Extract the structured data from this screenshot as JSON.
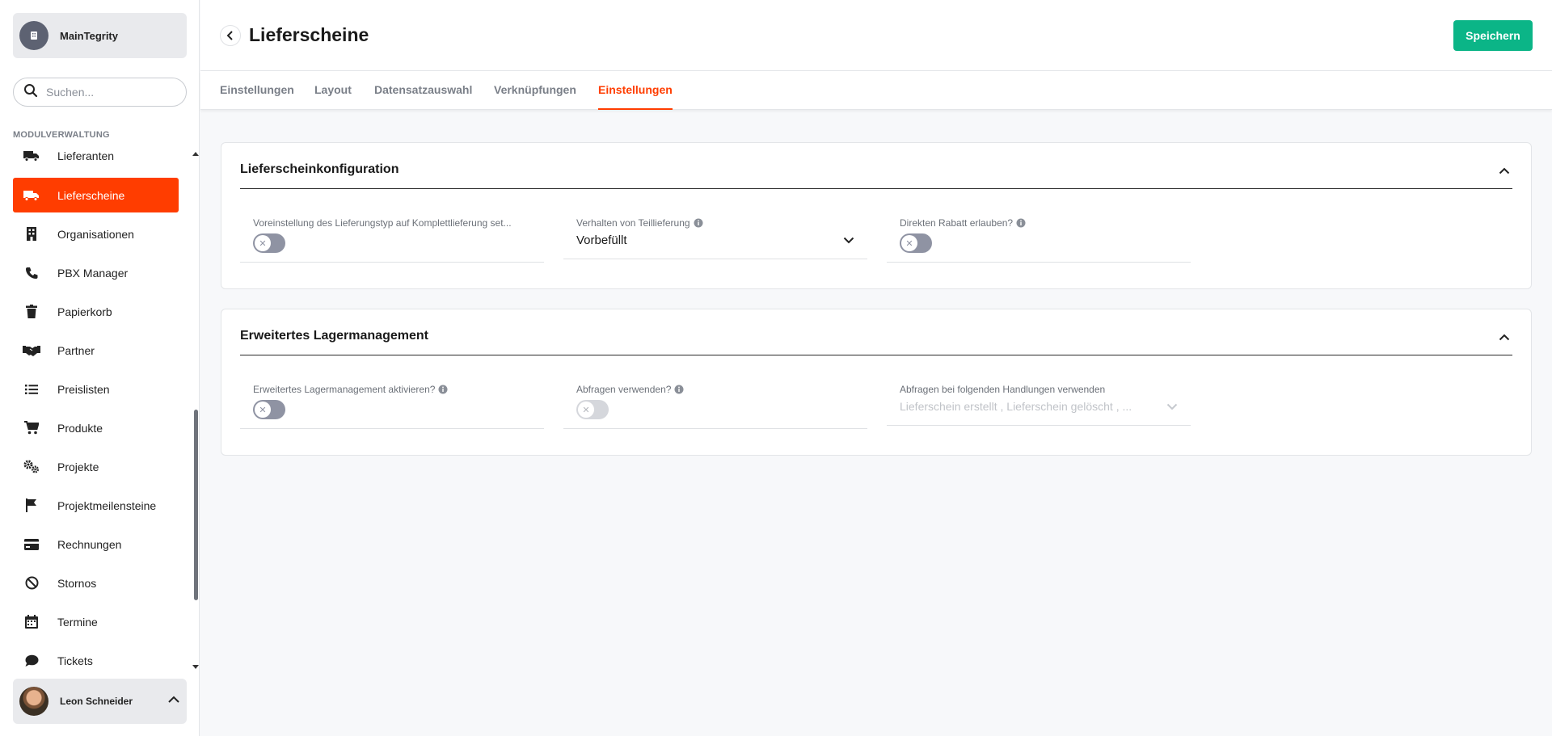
{
  "sidebar": {
    "org_name": "MainTegrity",
    "search_placeholder": "Suchen...",
    "section_label": "MODULVERWALTUNG",
    "items": [
      {
        "label": "Lieferanten",
        "icon": "truck-icon",
        "active": false
      },
      {
        "label": "Lieferscheine",
        "icon": "truck-icon",
        "active": true
      },
      {
        "label": "Organisationen",
        "icon": "building-icon",
        "active": false
      },
      {
        "label": "PBX Manager",
        "icon": "phone-icon",
        "active": false
      },
      {
        "label": "Papierkorb",
        "icon": "trash-icon",
        "active": false
      },
      {
        "label": "Partner",
        "icon": "handshake-icon",
        "active": false
      },
      {
        "label": "Preislisten",
        "icon": "list-icon",
        "active": false
      },
      {
        "label": "Produkte",
        "icon": "cart-icon",
        "active": false
      },
      {
        "label": "Projekte",
        "icon": "gears-icon",
        "active": false
      },
      {
        "label": "Projektmeilensteine",
        "icon": "flag-icon",
        "active": false
      },
      {
        "label": "Rechnungen",
        "icon": "credit-card-icon",
        "active": false
      },
      {
        "label": "Stornos",
        "icon": "ban-icon",
        "active": false
      },
      {
        "label": "Termine",
        "icon": "calendar-icon",
        "active": false
      },
      {
        "label": "Tickets",
        "icon": "chat-bubble-icon",
        "active": false
      }
    ],
    "user_name": "Leon Schneider"
  },
  "header": {
    "title": "Lieferscheine",
    "save_label": "Speichern"
  },
  "tabs": [
    {
      "label": "Einstellungen",
      "active": false
    },
    {
      "label": "Layout",
      "active": false
    },
    {
      "label": "Datensatzauswahl",
      "active": false
    },
    {
      "label": "Verknüpfungen",
      "active": false
    },
    {
      "label": "Einstellungen",
      "active": true
    }
  ],
  "sections": [
    {
      "title": "Lieferscheinkonfiguration",
      "fields": [
        {
          "label": "Voreinstellung des Lieferungstyp auf Komplettlieferung set...",
          "type": "switch",
          "on": false,
          "info": false
        },
        {
          "label": "Verhalten von Teillieferung",
          "type": "select",
          "value": "Vorbefüllt",
          "info": true
        },
        {
          "label": "Direkten Rabatt erlauben?",
          "type": "switch",
          "on": false,
          "info": true
        }
      ]
    },
    {
      "title": "Erweitertes Lagermanagement",
      "fields": [
        {
          "label": "Erweitertes Lagermanagement aktivieren?",
          "type": "switch",
          "on": false,
          "info": true
        },
        {
          "label": "Abfragen verwenden?",
          "type": "switch",
          "on": false,
          "disabled": true,
          "info": true
        },
        {
          "label": "Abfragen bei folgenden Handlungen verwenden",
          "type": "select",
          "value": "Lieferschein erstellt , Lieferschein gelöscht , ...",
          "disabled": true,
          "info": false
        }
      ]
    }
  ],
  "colors": {
    "accent": "#ff3d00",
    "save": "#0bb587",
    "switch_off": "#8f93a3"
  }
}
